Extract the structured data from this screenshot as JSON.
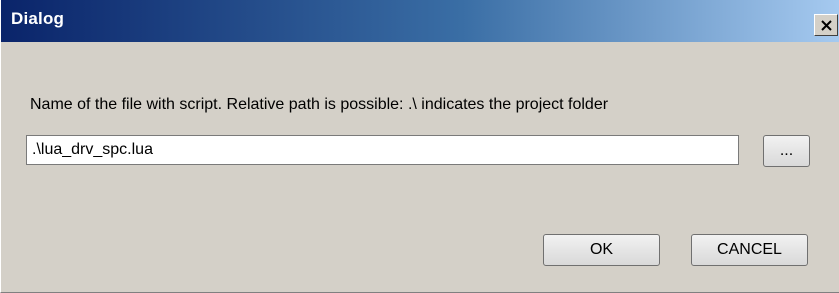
{
  "window": {
    "title": "Dialog",
    "close_icon": "close-icon"
  },
  "form": {
    "label": "Name of the file with script. Relative path is possible: .\\ indicates the project folder",
    "file_value": ".\\lua_drv_spc.lua",
    "browse_label": "...",
    "ok_label": "OK",
    "cancel_label": "CANCEL"
  },
  "colors": {
    "titlebar_start": "#0a246a",
    "titlebar_end": "#a6caf0",
    "dialog_background": "#d4d0c8"
  }
}
